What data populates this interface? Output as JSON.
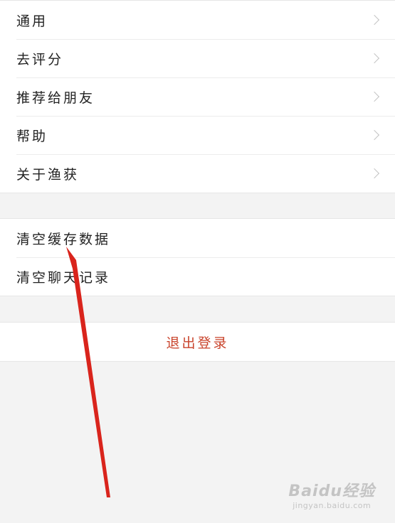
{
  "group1": {
    "items": [
      {
        "label": "通用"
      },
      {
        "label": "去评分"
      },
      {
        "label": "推荐给朋友"
      },
      {
        "label": "帮助"
      },
      {
        "label": "关于渔获"
      }
    ]
  },
  "group2": {
    "items": [
      {
        "label": "清空缓存数据"
      },
      {
        "label": "清空聊天记录"
      }
    ]
  },
  "logout": {
    "label": "退出登录"
  },
  "watermark": {
    "brand": "Baidu经验",
    "url": "jingyan.baidu.com"
  },
  "colors": {
    "logout_text": "#c9432b",
    "arrow": "#d9241c"
  }
}
